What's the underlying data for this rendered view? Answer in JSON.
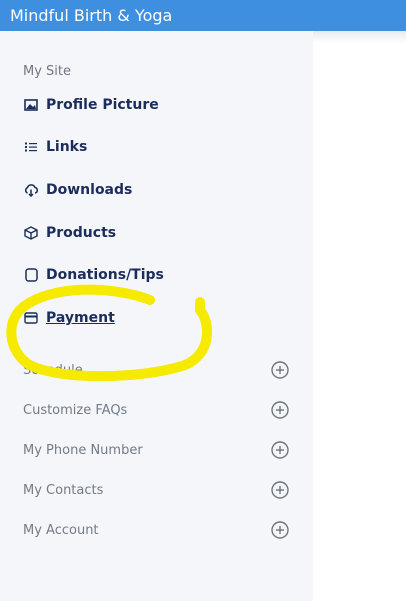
{
  "header": {
    "title": "Mindful Birth & Yoga"
  },
  "sidebar": {
    "section_label": "My Site",
    "items": [
      {
        "label": "Profile Picture",
        "icon": "image-icon"
      },
      {
        "label": "Links",
        "icon": "list-icon"
      },
      {
        "label": "Downloads",
        "icon": "cloud-download-icon"
      },
      {
        "label": "Products",
        "icon": "box-icon"
      },
      {
        "label": "Donations/Tips",
        "icon": "square-icon"
      },
      {
        "label": "Payment",
        "icon": "credit-card-icon"
      }
    ],
    "active_item": "Payment",
    "collapsibles": [
      {
        "label": "Schedule"
      },
      {
        "label": "Customize FAQs"
      },
      {
        "label": "My Phone Number"
      },
      {
        "label": "My Contacts"
      },
      {
        "label": "My Account"
      }
    ]
  },
  "colors": {
    "header_bg": "#3f8fe0",
    "sidebar_bg": "#f4f6fa",
    "nav_text": "#1c2d5a",
    "muted_text": "#737b87",
    "highlight_marker": "#f5ea00"
  }
}
